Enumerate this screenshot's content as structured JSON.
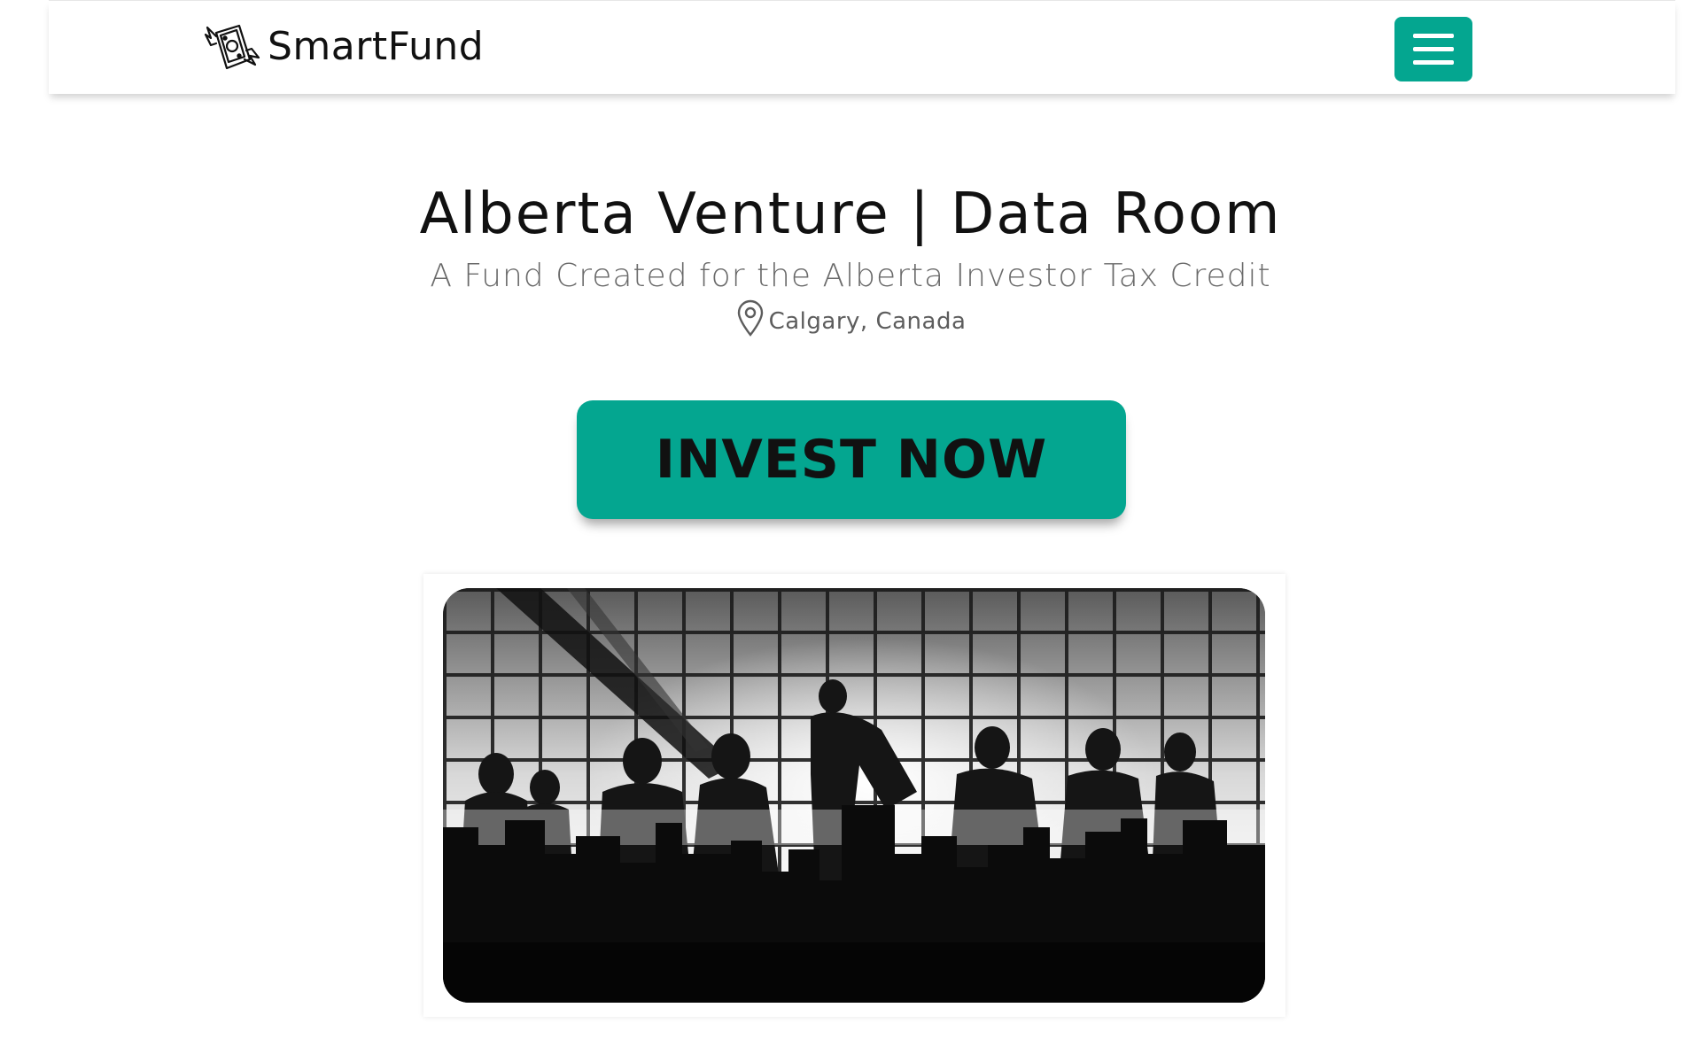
{
  "navbar": {
    "brand_name": "SmartFund",
    "logo_icon": "winged-money-icon",
    "menu_icon": "hamburger-menu-icon"
  },
  "hero": {
    "title": "Alberta Venture | Data Room",
    "subtitle": "A Fund Created for the Alberta Investor Tax Credit",
    "location_icon": "map-pin-icon",
    "location": "Calgary, Canada",
    "cta_label": "INVEST NOW"
  },
  "colors": {
    "accent": "#04a690",
    "text_dark": "#111111",
    "text_muted": "#6a6a6a"
  }
}
